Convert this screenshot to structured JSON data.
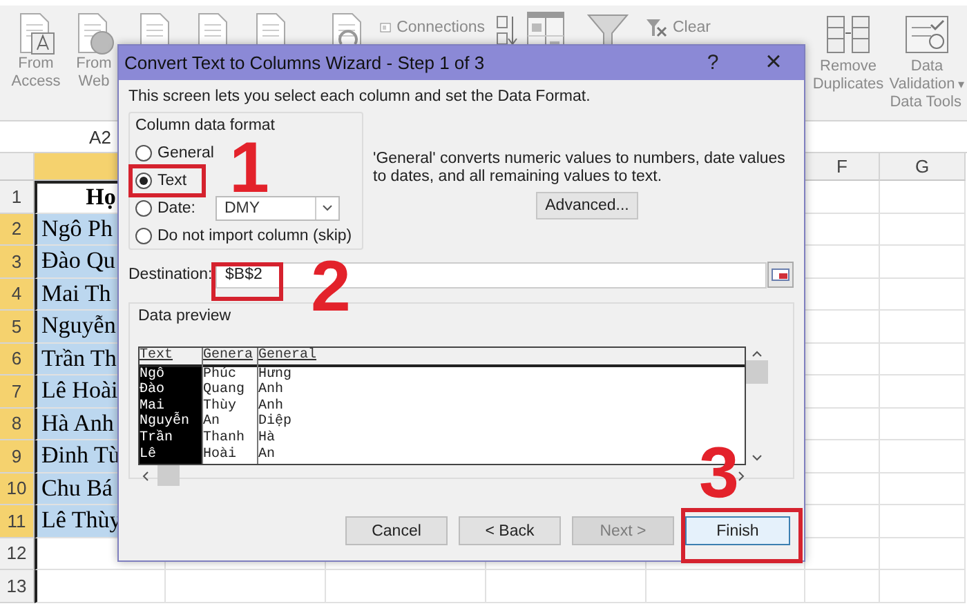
{
  "ribbon": {
    "items": [
      {
        "kind": "access",
        "label": "From Access"
      },
      {
        "kind": "web",
        "label": "From Web"
      },
      {
        "kind": "document"
      },
      {
        "kind": "document"
      },
      {
        "kind": "document"
      },
      {
        "kind": "refresh"
      },
      {
        "kind": "connections",
        "label": "Connections"
      },
      {
        "kind": "sort-az"
      },
      {
        "kind": "sort"
      },
      {
        "kind": "filter"
      },
      {
        "kind": "clear",
        "label": "Clear"
      },
      {
        "kind": "remove-duplicates",
        "label": "Remove Duplicates"
      },
      {
        "kind": "data-validation",
        "label": "Data Validation",
        "caret": "▾"
      }
    ],
    "group_label": "Data Tools"
  },
  "name_box": "A2",
  "columns": [
    {
      "selected": true
    },
    {
      "label": "F",
      "selected": false
    },
    {
      "label": "G",
      "selected": false
    }
  ],
  "rows": [
    {
      "number": "1",
      "cell": "Họ",
      "kind": "header",
      "selected": false
    },
    {
      "number": "2",
      "cell": "Ngô Ph",
      "kind": "data",
      "selected": true
    },
    {
      "number": "3",
      "cell": "Đào Qu",
      "kind": "data",
      "selected": true
    },
    {
      "number": "4",
      "cell": "Mai Th",
      "kind": "data",
      "selected": true
    },
    {
      "number": "5",
      "cell": "Nguyễn",
      "kind": "data",
      "selected": true
    },
    {
      "number": "6",
      "cell": "Trần Th",
      "kind": "data",
      "selected": true
    },
    {
      "number": "7",
      "cell": "Lê Hoài",
      "kind": "data",
      "selected": true
    },
    {
      "number": "8",
      "cell": "Hà Anh",
      "kind": "data",
      "selected": true
    },
    {
      "number": "9",
      "cell": "Đinh Tù",
      "kind": "data",
      "selected": true
    },
    {
      "number": "10",
      "cell": "Chu Bá",
      "kind": "data",
      "selected": true
    },
    {
      "number": "11",
      "cell": "Lê Thùy",
      "kind": "data",
      "selected": true
    },
    {
      "number": "12",
      "kind": "data",
      "selected": false
    },
    {
      "number": "13",
      "kind": "data",
      "selected": false
    }
  ],
  "dialog": {
    "title": "Convert Text to Columns Wizard - Step 1 of 3",
    "help": "?",
    "close": "×",
    "intro": "This screen lets you select each column and set the Data Format.",
    "column_format": {
      "legend": "Column data format",
      "options": [
        {
          "label": "General",
          "kind": "plain",
          "selected": false
        },
        {
          "label": "Text",
          "kind": "plain",
          "selected": true
        },
        {
          "label": "Date:",
          "kind": "date",
          "selected": false,
          "value": "DMY"
        },
        {
          "label": "Do not import column (skip)",
          "kind": "plain",
          "selected": false
        }
      ]
    },
    "description": "'General' converts numeric values to numbers, date values to dates, and all remaining values to text.",
    "advanced": "Advanced...",
    "destination": {
      "label": "Destination:",
      "value": "$B$2"
    },
    "preview": {
      "legend": "Data preview",
      "columns": [
        {
          "header": "Text",
          "selected": true,
          "values": [
            "Ngô",
            "Đào",
            "Mai",
            "Nguyễn",
            "Trần",
            "Lê"
          ]
        },
        {
          "header": "Genera",
          "selected": false,
          "values": [
            "Phúc",
            "Quang",
            "Thùy",
            "An",
            "Thanh",
            "Hoài"
          ]
        },
        {
          "header": "General",
          "selected": false,
          "values": [
            "Hưng",
            "Anh",
            "Anh",
            "Diệp",
            "Hà",
            "An"
          ]
        }
      ]
    },
    "buttons": [
      {
        "label": "Cancel",
        "disabled": false,
        "default": false
      },
      {
        "label": "< Back",
        "disabled": false,
        "default": false
      },
      {
        "label": "Next >",
        "disabled": true,
        "default": false
      },
      {
        "label": "Finish",
        "disabled": false,
        "default": true
      }
    ],
    "annotations": [
      {
        "label": "1"
      },
      {
        "label": "2"
      },
      {
        "label": "3"
      }
    ]
  }
}
